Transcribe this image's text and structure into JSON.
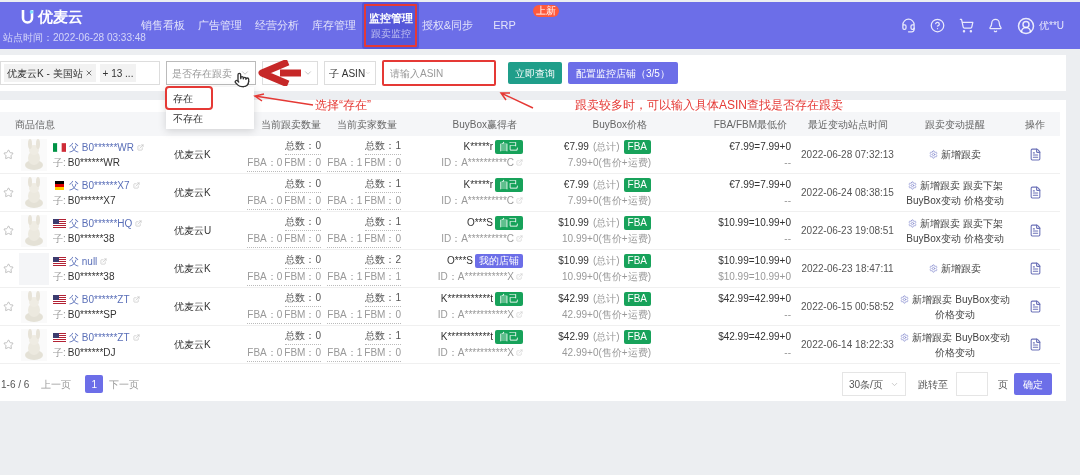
{
  "nav": {
    "logo": "优麦云",
    "site_time": "站点时间：2022-06-28 03:33:48",
    "items": [
      {
        "label": "销售看板",
        "selected": false,
        "boxed": false
      },
      {
        "label": "广告管理",
        "selected": false,
        "boxed": false
      },
      {
        "label": "经营分析",
        "selected": false,
        "boxed": false
      },
      {
        "label": "库存管理",
        "selected": false,
        "boxed": false
      },
      {
        "label": "监控管理",
        "selected": true,
        "boxed": true,
        "sub": "跟卖监控"
      },
      {
        "label": "授权&同步",
        "selected": false,
        "boxed": false
      },
      {
        "label": "ERP",
        "selected": false,
        "boxed": false,
        "badge": "上新"
      }
    ],
    "user": "优**U"
  },
  "filters": {
    "shop_tags": [
      {
        "label": "优麦云K - 美国站",
        "removable": true
      },
      {
        "label": "+ 13 ...",
        "removable": false
      }
    ],
    "follow_select": {
      "placeholder": "是否存在跟卖",
      "options": [
        {
          "label": "存在",
          "boxed": true
        },
        {
          "label": "不存在",
          "boxed": false
        }
      ]
    },
    "asin_type": "子 ASIN",
    "asin_input": {
      "placeholder": "请输入ASIN",
      "boxed": true
    },
    "search_button": "立即查询",
    "config_button": "配置监控店铺（3/5）"
  },
  "annotations": [
    "选择“存在”",
    "跟卖较多时，可以输入具体ASIN查找是否存在跟卖"
  ],
  "table": {
    "columns": [
      "商品信息",
      "当前跟卖数量",
      "当前卖家数量",
      "BuyBox赢得者",
      "BuyBox价格",
      "FBA/FBM最低价",
      "最近变动站点时间",
      "跟卖变动提醒",
      "操作"
    ],
    "rows": [
      {
        "image": true,
        "kind": "italy",
        "parent": "父 B0******WR",
        "child_label": "子:",
        "child": "B0******WR",
        "store": "优麦云K",
        "follow": {
          "total": "总数：0",
          "fba": "FBA：0",
          "fbm": "FBM：0"
        },
        "sellers": {
          "total": "总数：1",
          "fba": "FBA：1",
          "fbm": "FBM：0"
        },
        "winner": "K*****r",
        "badge": {
          "text": "自己",
          "kind": "self"
        },
        "winner_id": "ID：A**********C",
        "price": "€7.99",
        "price_note": "(总计)",
        "price_tag": "FBA",
        "price_detail": "7.99+0(售价+运费)",
        "lowest_fba": "€7.99=7.99+0",
        "lowest_fbm": "--",
        "time": "2022-06-28 07:32:13",
        "alerts": [
          "新增跟卖"
        ]
      },
      {
        "image": true,
        "kind": "germany",
        "parent": "父 B0******X7",
        "child_label": "子:",
        "child": "B0******X7",
        "store": "优麦云K",
        "follow": {
          "total": "总数：0",
          "fba": "FBA：0",
          "fbm": "FBM：0"
        },
        "sellers": {
          "total": "总数：1",
          "fba": "FBA：1",
          "fbm": "FBM：0"
        },
        "winner": "K*****r",
        "badge": {
          "text": "自己",
          "kind": "self"
        },
        "winner_id": "ID：A**********C",
        "price": "€7.99",
        "price_note": "(总计)",
        "price_tag": "FBA",
        "price_detail": "7.99+0(售价+运费)",
        "lowest_fba": "€7.99=7.99+0",
        "lowest_fbm": "--",
        "time": "2022-06-24 08:38:15",
        "alerts": [
          "新增跟卖",
          "跟卖下架",
          "BuyBox变动",
          "价格变动"
        ]
      },
      {
        "image": true,
        "kind": "usa",
        "parent": "父 B0******HQ",
        "child_label": "子:",
        "child": "B0******38",
        "store": "优麦云U",
        "follow": {
          "total": "总数：0",
          "fba": "FBA：0",
          "fbm": "FBM：0"
        },
        "sellers": {
          "total": "总数：1",
          "fba": "FBA：1",
          "fbm": "FBM：0"
        },
        "winner": "O***S",
        "badge": {
          "text": "自己",
          "kind": "self"
        },
        "winner_id": "ID：A**********C",
        "price": "$10.99",
        "price_note": "(总计)",
        "price_tag": "FBA",
        "price_detail": "10.99+0(售价+运费)",
        "lowest_fba": "$10.99=10.99+0",
        "lowest_fbm": "--",
        "time": "2022-06-23 19:08:51",
        "alerts": [
          "新增跟卖",
          "跟卖下架",
          "BuyBox变动",
          "价格变动"
        ]
      },
      {
        "image": false,
        "kind": "usa",
        "parent": "父 null",
        "child_label": "子:",
        "child": "B0******38",
        "store": "优麦云K",
        "follow": {
          "total": "总数：0",
          "fba": "FBA：0",
          "fbm": "FBM：0"
        },
        "sellers": {
          "total": "总数：2",
          "fba": "FBA：1",
          "fbm": "FBM：1"
        },
        "winner": "O***S",
        "badge": {
          "text": "我的店铺",
          "kind": "store"
        },
        "winner_id": "ID：A***********X",
        "price": "$10.99",
        "price_note": "(总计)",
        "price_tag": "FBA",
        "price_detail": "10.99+0(售价+运费)",
        "lowest_fba": "$10.99=10.99+0",
        "lowest_fbm": "$10.99=10.99+0",
        "time": "2022-06-23 18:47:11",
        "alerts": [
          "新增跟卖"
        ]
      },
      {
        "image": true,
        "kind": "usa",
        "parent": "父 B0******ZT",
        "child_label": "子:",
        "child": "B0******SP",
        "store": "优麦云K",
        "follow": {
          "total": "总数：0",
          "fba": "FBA：0",
          "fbm": "FBM：0"
        },
        "sellers": {
          "total": "总数：1",
          "fba": "FBA：1",
          "fbm": "FBM：0"
        },
        "winner": "K***********t",
        "badge": {
          "text": "自己",
          "kind": "self"
        },
        "winner_id": "ID：A***********X",
        "price": "$42.99",
        "price_note": "(总计)",
        "price_tag": "FBA",
        "price_detail": "42.99+0(售价+运费)",
        "lowest_fba": "$42.99=42.99+0",
        "lowest_fbm": "--",
        "time": "2022-06-15 00:58:52",
        "alerts": [
          "新增跟卖",
          "BuyBox变动",
          "价格变动"
        ]
      },
      {
        "image": true,
        "kind": "usa",
        "parent": "父 B0******ZT",
        "child_label": "子:",
        "child": "B0******DJ",
        "store": "优麦云K",
        "follow": {
          "total": "总数：0",
          "fba": "FBA：0",
          "fbm": "FBM：0"
        },
        "sellers": {
          "total": "总数：1",
          "fba": "FBA：1",
          "fbm": "FBM：0"
        },
        "winner": "K***********t",
        "badge": {
          "text": "自己",
          "kind": "self"
        },
        "winner_id": "ID：A***********X",
        "price": "$42.99",
        "price_note": "(总计)",
        "price_tag": "FBA",
        "price_detail": "42.99+0(售价+运费)",
        "lowest_fba": "$42.99=42.99+0",
        "lowest_fbm": "--",
        "time": "2022-06-14 18:22:33",
        "alerts": [
          "新增跟卖",
          "BuyBox变动",
          "价格变动"
        ]
      }
    ]
  },
  "pagination": {
    "range": "1-6 / 6",
    "prev": {
      "label": "上一页",
      "disabled": true
    },
    "pages": [
      {
        "label": "1",
        "selected": true
      }
    ],
    "next": {
      "label": "下一页",
      "disabled": true
    },
    "page_size": "30条/页",
    "jump_label": "跳转至",
    "page_unit": "页",
    "confirm": "确定"
  }
}
